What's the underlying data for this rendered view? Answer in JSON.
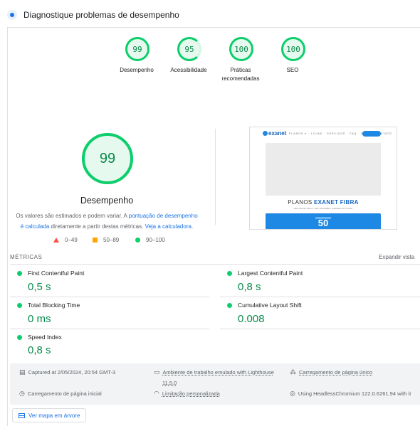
{
  "header": {
    "title": "Diagnostique problemas de desempenho"
  },
  "gauges": [
    {
      "score": "99",
      "label": "Desempenho"
    },
    {
      "score": "95",
      "label": "Acessibilidade"
    },
    {
      "score": "100",
      "label": "Práticas recomendadas"
    },
    {
      "score": "100",
      "label": "SEO"
    }
  ],
  "performance": {
    "score": "99",
    "label": "Desempenho",
    "disclaimer_prefix": "Os valores são estimados e podem variar. A ",
    "disclaimer_link": "pontuação de desempenho é calculada",
    "disclaimer_middle": " diretamente a partir destas métricas. ",
    "calculator_link": "Veja a calculadora",
    "disclaimer_suffix": "."
  },
  "legend": [
    {
      "shape": "triangle",
      "range": "0–49",
      "color": "#ff4e42"
    },
    {
      "shape": "square",
      "range": "50–89",
      "color": "#ffa400"
    },
    {
      "shape": "circle",
      "range": "90–100",
      "color": "#0cce6b"
    }
  ],
  "screenshot": {
    "logo": "exanet",
    "nav_links": "PLANOS ▾  · LOJAS · SERVIÇOS · FAQ · BLOG · CONTATO",
    "heading_plain": "PLANOS ",
    "heading_bold": "EXANET FIBRA",
    "subtext": "Mais Internet Fibra e mais velocidade e qualidade de conexão",
    "card_value": "50"
  },
  "metrics": {
    "header": "MÉTRICAS",
    "expand_label": "Expandir vista",
    "items": [
      {
        "name": "First Contentful Paint",
        "value": "0,5 s"
      },
      {
        "name": "Largest Contentful Paint",
        "value": "0,8 s"
      },
      {
        "name": "Total Blocking Time",
        "value": "0 ms"
      },
      {
        "name": "Cumulative Layout Shift",
        "value": "0.008"
      },
      {
        "name": "Speed Index",
        "value": "0,8 s"
      }
    ]
  },
  "runtime": {
    "captured": "Captured at 2/05/2024, 20:54 GMT-3",
    "environment": "Ambiente de trabalho emulado with Lighthouse",
    "version": "11.5.0",
    "single_page": "Carregamento de página único",
    "initial_load": "Carregamento de página inicial",
    "throttling": "Limitação personalizada",
    "browser": "Using HeadlessChromium 122.0.6261.94 with lr"
  },
  "tree_button": "Ver mapa em árvore",
  "colors": {
    "pass": "#0cce6b",
    "pass_text": "#088a48",
    "link": "#1a73e8"
  }
}
